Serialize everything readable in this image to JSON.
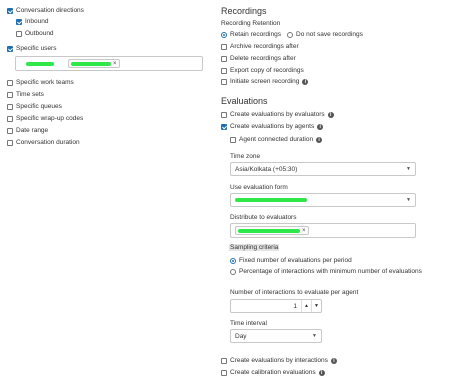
{
  "left": {
    "conversation_directions": "Conversation directions",
    "inbound": "Inbound",
    "outbound": "Outbound",
    "specific_users": "Specific users",
    "filters": [
      "Specific work teams",
      "Time sets",
      "Specific queues",
      "Specific wrap-up codes",
      "Date range",
      "Conversation duration"
    ]
  },
  "recordings": {
    "heading": "Recordings",
    "retention_label": "Recording Retention",
    "retain": "Retain recordings",
    "do_not_save": "Do not save recordings",
    "archive": "Archive recordings after",
    "delete": "Delete recordings after",
    "export": "Export copy of recordings",
    "initiate": "Initiate screen recording"
  },
  "evaluations": {
    "heading": "Evaluations",
    "by_evaluators": "Create evaluations by evaluators",
    "by_agents": "Create evaluations by agents",
    "agent_connected_duration": "Agent connected duration",
    "time_zone_label": "Time zone",
    "time_zone_value": "Asia/Kolkata (+05:30)",
    "use_form_label": "Use evaluation form",
    "distribute_label": "Distribute to evaluators",
    "sampling_label": "Sampling criteria",
    "fixed_number": "Fixed number of evaluations per period",
    "percentage": "Percentage of interactions with minimum number of evaluations",
    "num_interactions_label": "Number of interactions to evaluate per agent",
    "num_interactions_value": "1",
    "time_interval_label": "Time interval",
    "time_interval_value": "Day",
    "by_interactions": "Create evaluations by interactions",
    "calibration": "Create calibration evaluations"
  },
  "icons": {
    "info": "info-icon",
    "caret": "chevron-down-icon",
    "remove": "close-icon"
  },
  "colors": {
    "accent": "#1f6fb5",
    "redaction": "#2ee84a",
    "sampling_highlight": "#e3e3e3"
  }
}
